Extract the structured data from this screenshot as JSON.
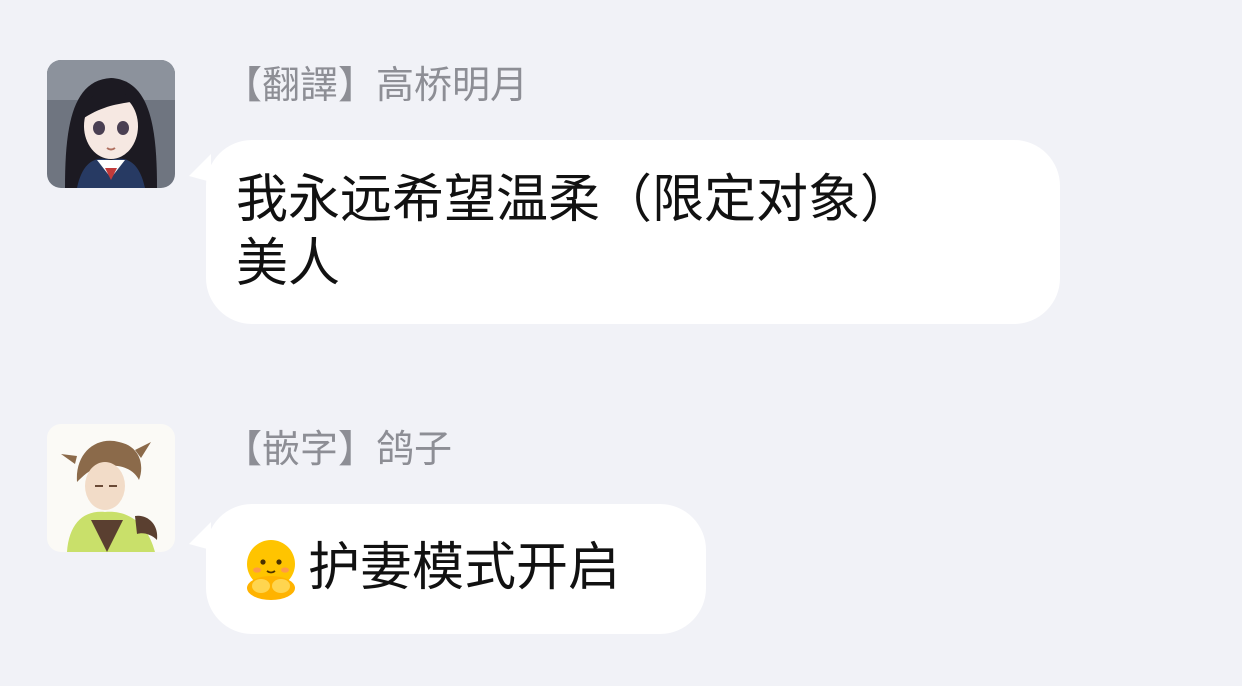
{
  "messages": [
    {
      "tag": "【翻譯】",
      "sender_name": "高桥明月",
      "text_line1": "我永远希望温柔（限定对象）",
      "text_line2": "美人",
      "avatar_icon": "anime-girl-avatar"
    },
    {
      "tag": "【嵌字】",
      "sender_name": "鸽子",
      "emoji_icon": "shy-emoji",
      "text": "护妻模式开启",
      "avatar_icon": "anime-boy-avatar"
    }
  ],
  "colors": {
    "background": "#f1f2f7",
    "bubble": "#ffffff",
    "sender_text": "#8d8e95",
    "message_text": "#111111",
    "emoji_yellow": "#ffc400"
  }
}
